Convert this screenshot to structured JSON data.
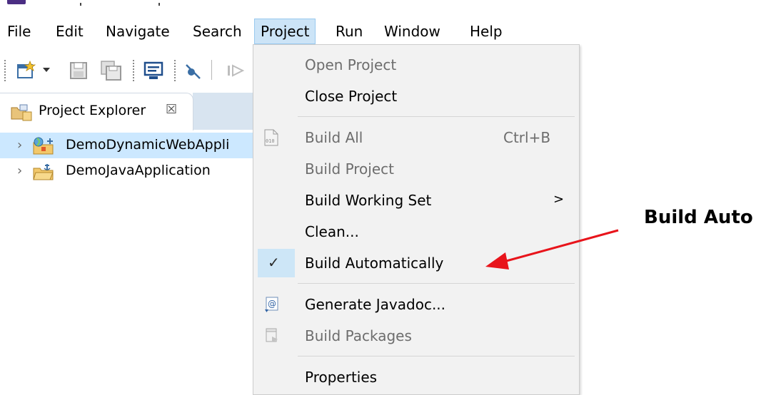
{
  "menubar": {
    "items": [
      "File",
      "Edit",
      "Navigate",
      "Search",
      "Project",
      "Run",
      "Window",
      "Help"
    ],
    "active": "Project"
  },
  "view": {
    "tab_label": "Project Explorer",
    "close_glyph": "☒"
  },
  "tree": {
    "items": [
      {
        "label": "DemoDynamicWebAppli",
        "selected": true
      },
      {
        "label": "DemoJavaApplication",
        "selected": false
      }
    ]
  },
  "project_menu": {
    "open_project": "Open Project",
    "close_project": "Close Project",
    "build_all": "Build All",
    "build_all_shortcut": "Ctrl+B",
    "build_project": "Build Project",
    "build_working_set": "Build Working Set",
    "submenu_arrow": ">",
    "clean": "Clean...",
    "check_glyph": "✓",
    "build_automatically": "Build Automatically",
    "generate_javadoc": "Generate Javadoc...",
    "build_packages": "Build Packages",
    "properties": "Properties"
  },
  "annotation": {
    "text": "Build Auto",
    "arrow_color": "#e8141b"
  },
  "colors": {
    "menu_active_bg": "#cce4f7",
    "selection_bg": "#cce8ff",
    "dropdown_bg": "#f2f2f2",
    "disabled_text": "#6d6d6d"
  }
}
